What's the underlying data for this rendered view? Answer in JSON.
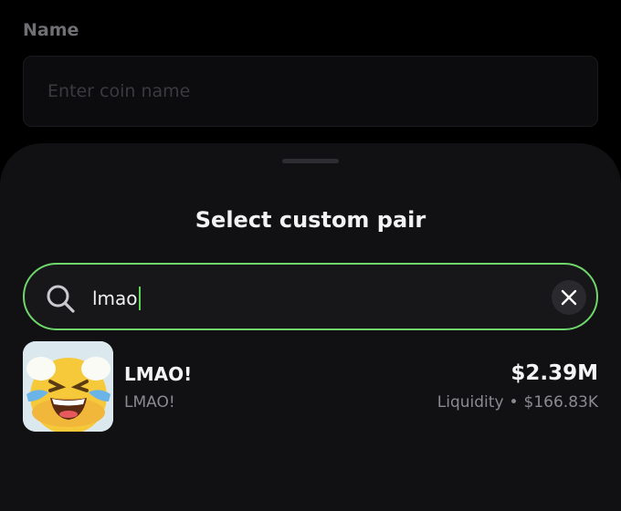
{
  "form": {
    "name_label": "Name",
    "name_placeholder": "Enter coin name",
    "name_value": ""
  },
  "sheet": {
    "title": "Select custom pair",
    "search": {
      "value": "lmao",
      "placeholder": "",
      "icon": "search-icon",
      "clear_icon": "close-icon"
    },
    "results": [
      {
        "name": "LMAO!",
        "symbol": "LMAO!",
        "price": "$2.39M",
        "liquidity_label": "Liquidity",
        "separator": "•",
        "liquidity_value": "$166.83K",
        "avatar_icon": "laughing-emoji-icon"
      }
    ]
  },
  "colors": {
    "background": "#000000",
    "sheet": "#111113",
    "accent_green": "#6fd66b",
    "text_primary": "#f4f4f6",
    "text_secondary": "#8a8a90"
  }
}
